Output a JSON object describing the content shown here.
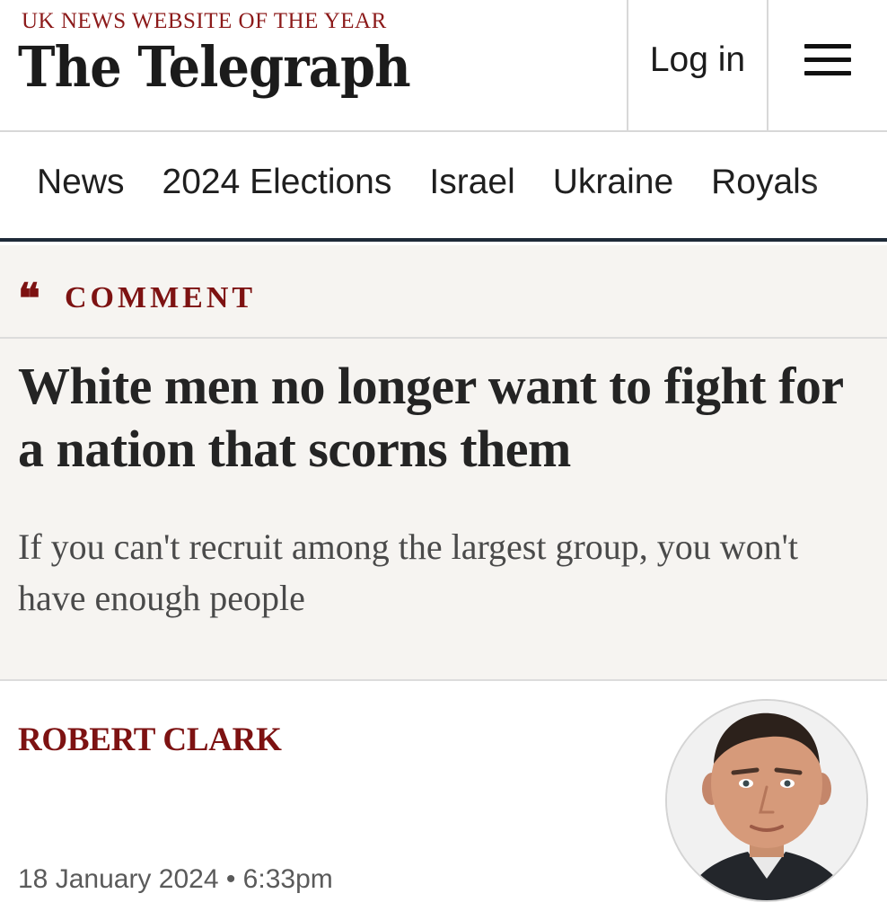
{
  "header": {
    "tagline": "UK NEWS WEBSITE OF THE YEAR",
    "logo": "The Telegraph",
    "login_label": "Log in",
    "menu_icon": "hamburger-menu-icon"
  },
  "nav": {
    "items": [
      {
        "label": "News"
      },
      {
        "label": "2024 Elections"
      },
      {
        "label": "Israel"
      },
      {
        "label": "Ukraine"
      },
      {
        "label": "Royals"
      }
    ]
  },
  "article": {
    "kicker_icon": "quote-icon",
    "kicker": "COMMENT",
    "headline": "White men no longer want to fight for a nation that scorns them",
    "standfirst": "If you can't recruit among the largest group, you won't have enough people",
    "author": "ROBERT CLARK",
    "date": "18 January 2024 • 6:33pm"
  },
  "colors": {
    "brand_red": "#7d1212",
    "hero_background": "#f6f4f1",
    "nav_rule": "#1e2a38"
  }
}
